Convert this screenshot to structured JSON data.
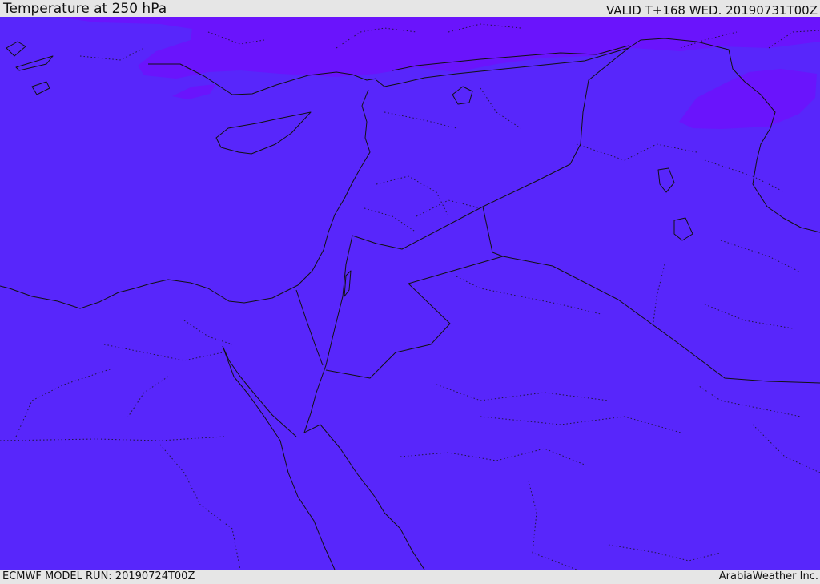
{
  "header": {
    "title": "Temperature at 250 hPa",
    "valid_time": "VALID T+168 WED. 20190731T00Z"
  },
  "footer": {
    "model_run": "ECMWF MODEL RUN: 20190724T00Z",
    "credit": "ArabiaWeather Inc."
  },
  "map": {
    "field_color": "#5826fb",
    "cold_pocket_color": "#6a14fc",
    "border_color": "#111111"
  }
}
